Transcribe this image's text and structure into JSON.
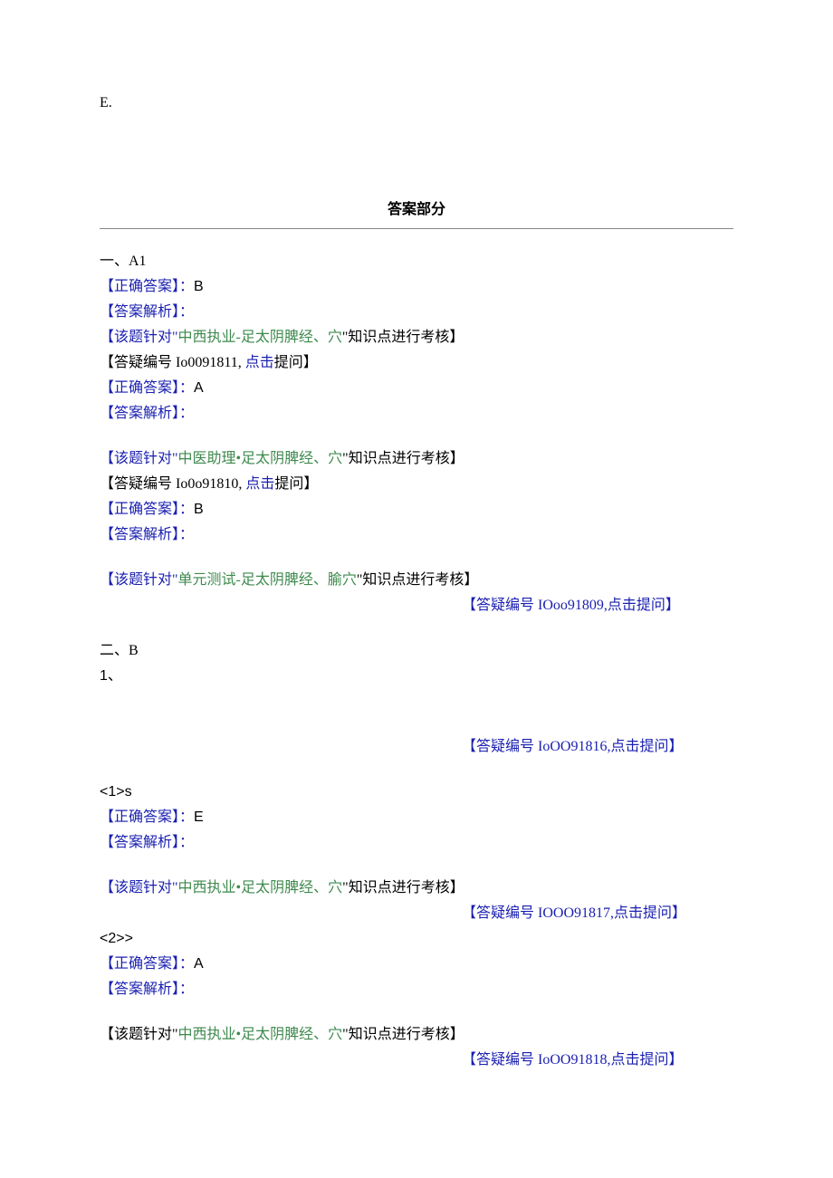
{
  "optionE": "E.",
  "answerHeader": "答案部分",
  "sec1": {
    "header": "一、A1",
    "q1": {
      "correct_label": "【正确答案】：",
      "correct_val": "B",
      "analysis_label": "【答案解析】：",
      "note_pre": "【该题针对\"",
      "note_topic": "中西执业-足太阴脾经、穴",
      "note_post": "\"知识点进行考核】",
      "dy_pre": "【答疑编号 Io0091811, ",
      "dy_link": "点击",
      "dy_post": "提问】"
    },
    "q2": {
      "correct_label": "【正确答案】：",
      "correct_val": "A",
      "analysis_label": "【答案解析】：",
      "note_pre": "【该题针对\"",
      "note_topic": "中医助理•足太阴脾经、穴",
      "note_post": "\"知识点进行考核】",
      "dy_pre": "【答疑编号 Io0o91810, ",
      "dy_link": "点击",
      "dy_post": "提问】"
    },
    "q3": {
      "correct_label": "【正确答案】：",
      "correct_val": "B",
      "analysis_label": "【答案解析】：",
      "note_pre": "【该题针对\"",
      "note_topic": "单元测试-足太阴脾经、腧穴",
      "note_post": "\"知识点进行考核】",
      "dy_full": "【答疑编号 IOoo91809,点击提问】"
    }
  },
  "sec2": {
    "header": "二、B",
    "group": "1、",
    "group_dy": "【答疑编号 IoOO91816,点击提问】",
    "sub1": {
      "num": "<1>s",
      "correct_label": "【正确答案】：",
      "correct_val": "E",
      "analysis_label": "【答案解析】：",
      "note_pre": "【该题针对\"",
      "note_topic": "中西执业•足太阴脾经、穴",
      "note_post": "\"知识点进行考核】",
      "dy_full": "【答疑编号 IOOO91817,点击提问】"
    },
    "sub2": {
      "num": "<2>>",
      "correct_label": "【正确答案】：",
      "correct_val": "A",
      "analysis_label": "【答案解析】：",
      "note_pre": "【该题针对\"",
      "note_topic": "中西执业•足太阴脾经、穴",
      "note_post": "\"知识点进行考核】",
      "dy_full": "【答疑编号 IoOO91818,点击提问】"
    }
  }
}
